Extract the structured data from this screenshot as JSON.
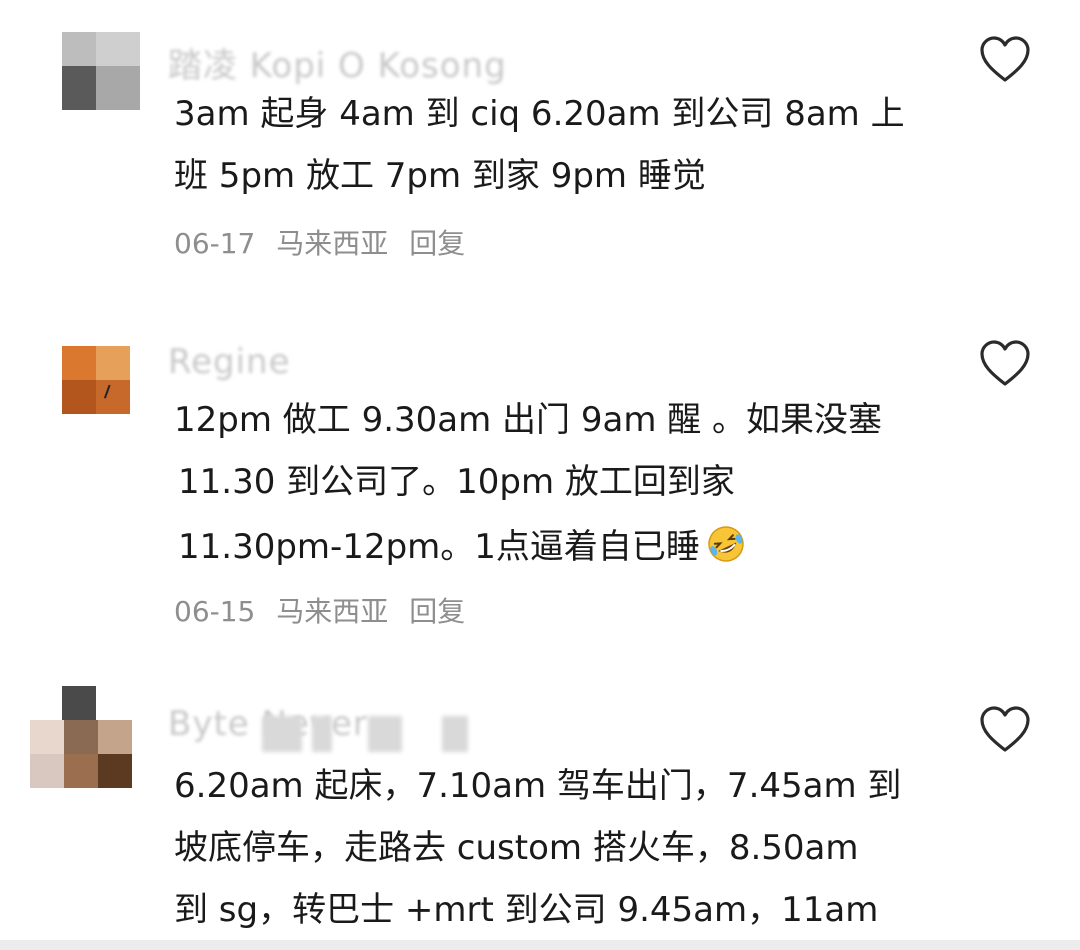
{
  "comments": [
    {
      "username": "踏凌 Kopi O Kosong",
      "lines": [
        "3am 起身 4am 到 ciq 6.20am 到公司 8am 上",
        "班 5pm 放工 7pm 到家 9pm 睡觉"
      ],
      "date": "06-17",
      "location": "马来西亚",
      "reply": "回复",
      "like_icon": "heart-outline-icon"
    },
    {
      "username": "Regine",
      "lines": [
        "12pm 做工 9.30am 出门 9am 醒 。如果没塞",
        "11.30 到公司了。10pm 放工回到家",
        "11.30pm-12pm。1点逼着自已睡"
      ],
      "emoji": "rolling-on-floor-laughing-emoji",
      "date": "06-15",
      "location": "马来西亚",
      "reply": "回复",
      "like_icon": "heart-outline-icon"
    },
    {
      "username": "Byte Never",
      "lines": [
        "6.20am 起床，7.10am 驾车出门，7.45am 到",
        "坡底停车，走路去 custom 搭火车，8.50am",
        "到 sg，转巴士 +mrt 到公司 9.45am，11am"
      ],
      "like_icon": "heart-outline-icon"
    }
  ],
  "colors": {
    "text": "#1a1a1a",
    "meta": "#8e8e8e",
    "username": "#c8c8c8",
    "heart": "#2b2b2b"
  }
}
